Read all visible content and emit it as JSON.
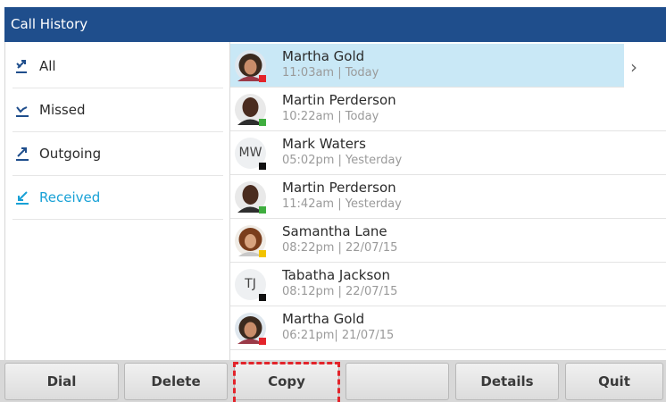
{
  "title": "Call History",
  "filters": [
    {
      "label": "All",
      "icon": "all-calls-icon",
      "active": false
    },
    {
      "label": "Missed",
      "icon": "missed-call-icon",
      "active": false
    },
    {
      "label": "Outgoing",
      "icon": "outgoing-call-icon",
      "active": false
    },
    {
      "label": "Received",
      "icon": "received-call-icon",
      "active": true
    }
  ],
  "calls": [
    {
      "name": "Martha Gold",
      "detail": "11:03am | Today",
      "avatar": "photo",
      "presence_color": "#e3242b",
      "selected": true
    },
    {
      "name": "Martin Perderson",
      "detail": "10:22am | Today",
      "avatar": "photo",
      "presence_color": "#3fae3f",
      "selected": false
    },
    {
      "name": "Mark Waters",
      "detail": "05:02pm | Yesterday",
      "avatar_initials": "MW",
      "presence_color": "#111111",
      "selected": false
    },
    {
      "name": "Martin Perderson",
      "detail": "11:42am | Yesterday",
      "avatar": "photo",
      "presence_color": "#3fae3f",
      "selected": false
    },
    {
      "name": "Samantha Lane",
      "detail": "08:22pm | 22/07/15",
      "avatar": "photo",
      "presence_color": "#f2c300",
      "selected": false
    },
    {
      "name": "Tabatha Jackson",
      "detail": "08:12pm | 22/07/15",
      "avatar_initials": "TJ",
      "presence_color": "#111111",
      "selected": false
    },
    {
      "name": "Martha Gold",
      "detail": "06:21pm| 21/07/15",
      "avatar": "photo",
      "presence_color": "#e3242b",
      "selected": false
    }
  ],
  "softkeys": [
    "Dial",
    "Delete",
    "Copy",
    "",
    "Details",
    "Quit"
  ],
  "chevron_icon": "chevron-right-icon",
  "colors": {
    "titlebar": "#1f4e8c",
    "active_filter": "#18a1d6",
    "selected_row": "#c9e8f6",
    "highlight": "#e3242b"
  }
}
